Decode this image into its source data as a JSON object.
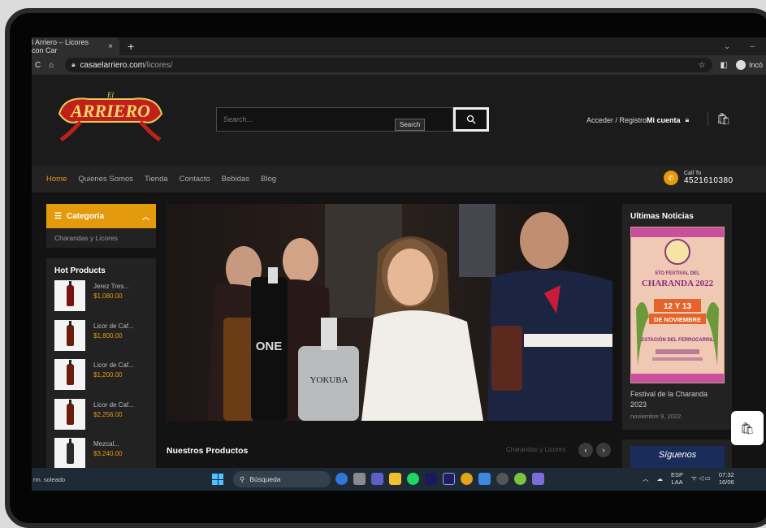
{
  "browser": {
    "tab_title": "l Arriero – Licores con Car",
    "tab_close": "×",
    "new_tab": "+",
    "url_host": "casaelarriero.com",
    "url_path": "/licores/",
    "incognito_label": "Incó"
  },
  "site": {
    "search_placeholder": "Search...",
    "search_tooltip": "Search",
    "account_prefix": "Acceder / Registro",
    "account_bold": "Mi cuenta",
    "nav": [
      "Home",
      "Quienes Somos",
      "Tienda",
      "Contacto",
      "Bebidas",
      "Blog"
    ],
    "call_label": "Call To",
    "call_number": "4521610380",
    "category_title": "Categoria",
    "category_item": "Charandas y Licores",
    "hot_title": "Hot Products",
    "products": [
      {
        "name": "Jerez Tres...",
        "price": "$1,080.00"
      },
      {
        "name": "Licor de Caf...",
        "price": "$1,800.00"
      },
      {
        "name": "Licor de Caf...",
        "price": "$1,200.00"
      },
      {
        "name": "Licor de Caf...",
        "price": "$2,256.00"
      },
      {
        "name": "Mezcal...",
        "price": "$3,240.00"
      }
    ],
    "section_title": "Nuestros Productos",
    "section_link": "Charandas y Licores",
    "news_title": "Ultimas Noticias",
    "news_item_title": "Festival de la Charanda 2023",
    "news_item_date": "noviembre 9, 2022",
    "poster_lines": [
      "5TO FESTIVAL DEL",
      "CHARANDA 2022",
      "12 Y 13",
      "DE NOVIEMBRE",
      "ESTACIÓN DEL FERROCARRIL"
    ],
    "follow_text": "Síguenos"
  },
  "taskbar": {
    "weather": "rm. soleado",
    "search_label": "Búsqueda",
    "lang": "ESP",
    "lang2": "LAA",
    "time": "07:32",
    "date": "16/06"
  },
  "colors": {
    "accent": "#e39a0c"
  }
}
